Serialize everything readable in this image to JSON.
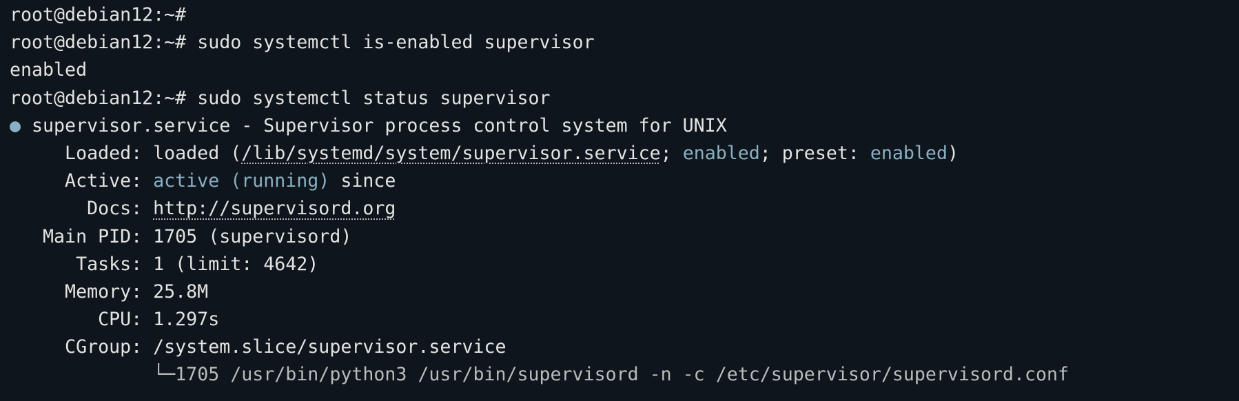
{
  "terminal": {
    "prompt": "root@debian12:~#",
    "lines": {
      "l1": {
        "prompt": "root@debian12:~#"
      },
      "l2": {
        "prompt": "root@debian12:~#",
        "cmd": " sudo systemctl is-enabled supervisor"
      },
      "l3": {
        "output": "enabled"
      },
      "l4": {
        "prompt": "root@debian12:~#",
        "cmd": " sudo systemctl status supervisor"
      }
    },
    "status": {
      "bullet": "●",
      "unit_line": " supervisor.service - Supervisor process control system for UNIX",
      "loaded": {
        "label": "     Loaded: ",
        "value": "loaded (",
        "path": "/lib/systemd/system/supervisor.service",
        "sep1": "; ",
        "state": "enabled",
        "sep2": "; preset: ",
        "preset": "enabled",
        "close": ")"
      },
      "active": {
        "label": "     Active: ",
        "state": "active (running)",
        "rest": " since"
      },
      "docs": {
        "label": "       Docs: ",
        "url": "http://supervisord.org"
      },
      "main_pid": {
        "label": "   Main PID: ",
        "value": "1705 (supervisord)"
      },
      "tasks": {
        "label": "      Tasks: ",
        "value": "1 (limit: 4642)"
      },
      "memory": {
        "label": "     Memory: ",
        "value": "25.8M"
      },
      "cpu": {
        "label": "        CPU: ",
        "value": "1.297s"
      },
      "cgroup": {
        "label": "     CGroup: ",
        "value": "/system.slice/supervisor.service"
      },
      "process": {
        "indent": "             ",
        "tree": "└─",
        "value": "1705 /usr/bin/python3 /usr/bin/supervisord -n -c /etc/supervisor/supervisord.conf"
      }
    },
    "colors": {
      "background": "#0e151c",
      "text": "#e3e4e2",
      "accent": "#8ab0c3",
      "dim": "#b9bcba"
    }
  }
}
